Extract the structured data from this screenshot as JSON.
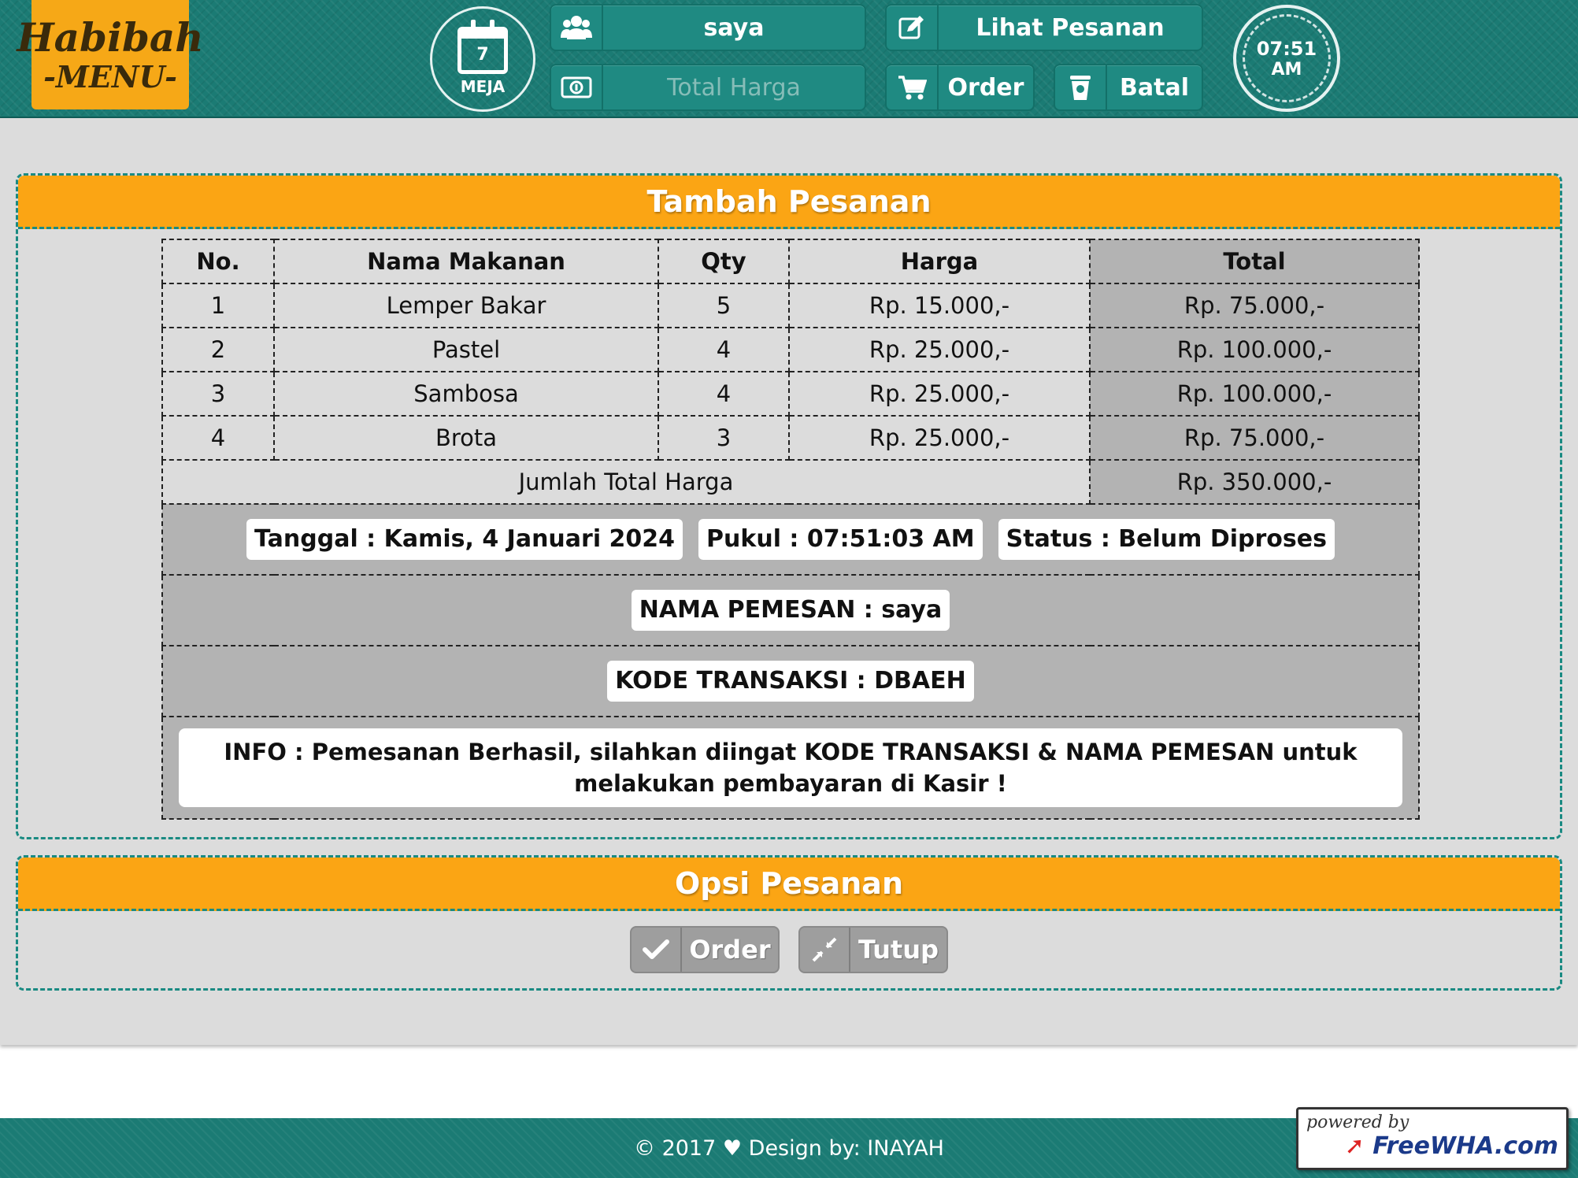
{
  "header": {
    "logo": {
      "line1": "Habibah",
      "line2": "-MENU-"
    },
    "table_badge": {
      "number": "7",
      "label": "MEJA"
    },
    "user_name": "saya",
    "total_price_placeholder": "Total Harga",
    "view_orders_label": "Lihat Pesanan",
    "order_label": "Order",
    "cancel_label": "Batal",
    "clock": {
      "time": "07:51",
      "period": "AM"
    }
  },
  "add_order": {
    "title": "Tambah Pesanan",
    "columns": [
      "No.",
      "Nama Makanan",
      "Qty",
      "Harga",
      "Total"
    ],
    "rows": [
      {
        "no": "1",
        "name": "Lemper Bakar",
        "qty": "5",
        "price": "Rp. 15.000,-",
        "total": "Rp. 75.000,-"
      },
      {
        "no": "2",
        "name": "Pastel",
        "qty": "4",
        "price": "Rp. 25.000,-",
        "total": "Rp. 100.000,-"
      },
      {
        "no": "3",
        "name": "Sambosa",
        "qty": "4",
        "price": "Rp. 25.000,-",
        "total": "Rp. 100.000,-"
      },
      {
        "no": "4",
        "name": "Brota",
        "qty": "3",
        "price": "Rp. 25.000,-",
        "total": "Rp. 75.000,-"
      }
    ],
    "grand_total_label": "Jumlah Total Harga",
    "grand_total_value": "Rp. 350.000,-",
    "date": "Tanggal : Kamis, 4 Januari 2024",
    "time": "Pukul : 07:51:03 AM",
    "status": "Status : Belum Diproses",
    "customer_name": "NAMA PEMESAN : saya",
    "transaction_code": "KODE TRANSAKSI : DBAEH",
    "info": "INFO : Pemesanan Berhasil, silahkan diingat KODE TRANSAKSI & NAMA PEMESAN untuk melakukan pembayaran di Kasir !"
  },
  "order_options": {
    "title": "Opsi Pesanan",
    "order_label": "Order",
    "close_label": "Tutup"
  },
  "footer": {
    "copyright": "© 2017 ♥ Design by: INAYAH",
    "badge_line1": "powered by",
    "badge_line2": "FreeWHA.com"
  },
  "colors": {
    "teal": "#1b7b74",
    "orange": "#fba514",
    "gray_cell": "#b3b3b3",
    "panel_bg": "#dcdcdc"
  }
}
